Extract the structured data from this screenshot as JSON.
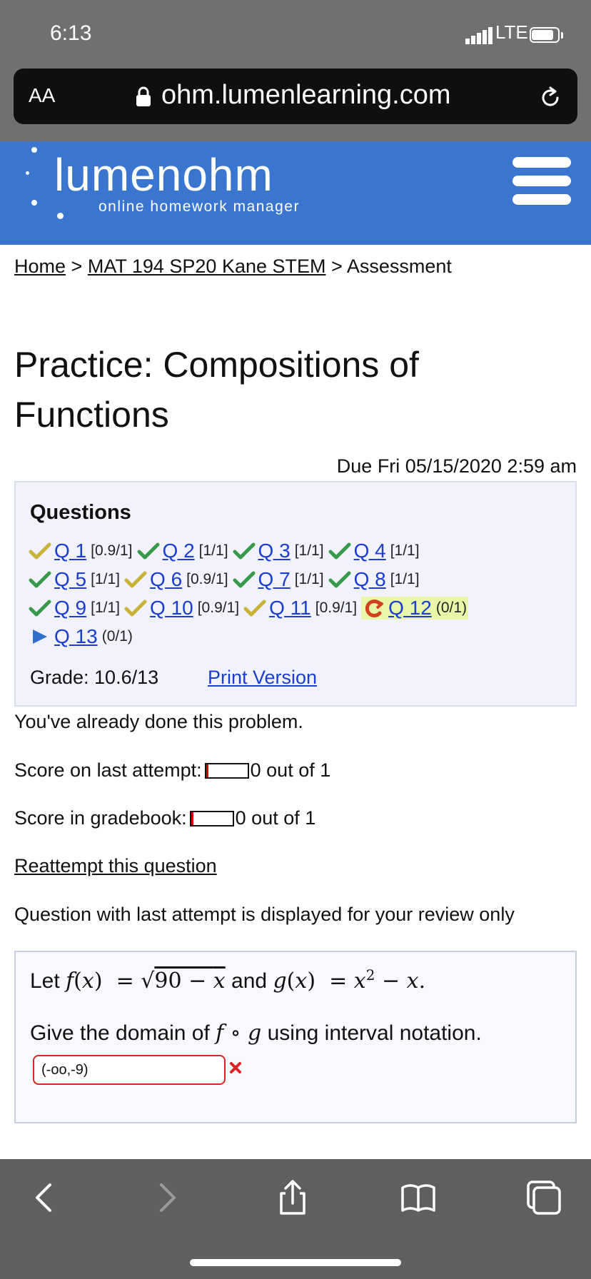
{
  "status": {
    "time": "6:13",
    "network": "LTE"
  },
  "browser": {
    "text_size": "AA",
    "url": "ohm.lumenlearning.com"
  },
  "header": {
    "logo": "lumenohm",
    "tagline": "online homework manager"
  },
  "breadcrumb": {
    "home": "Home",
    "course": "MAT 194 SP20 Kane STEM",
    "current": "Assessment",
    "sep": ">"
  },
  "title": "Practice: Compositions of Functions",
  "due": "Due Fri 05/15/2020 2:59 am",
  "questions": {
    "heading": "Questions",
    "items": [
      {
        "label": "Q 1",
        "score": "[0.9/1]",
        "status": "partial"
      },
      {
        "label": "Q 2",
        "score": "[1/1]",
        "status": "correct"
      },
      {
        "label": "Q 3",
        "score": "[1/1]",
        "status": "correct"
      },
      {
        "label": "Q 4",
        "score": "[1/1]",
        "status": "correct"
      },
      {
        "label": "Q 5",
        "score": "[1/1]",
        "status": "correct"
      },
      {
        "label": "Q 6",
        "score": "[0.9/1]",
        "status": "partial"
      },
      {
        "label": "Q 7",
        "score": "[1/1]",
        "status": "correct"
      },
      {
        "label": "Q 8",
        "score": "[1/1]",
        "status": "correct"
      },
      {
        "label": "Q 9",
        "score": "[1/1]",
        "status": "correct"
      },
      {
        "label": "Q 10",
        "score": "[0.9/1]",
        "status": "partial"
      },
      {
        "label": "Q 11",
        "score": "[0.9/1]",
        "status": "partial"
      },
      {
        "label": "Q 12",
        "score": "(0/1)",
        "status": "retry"
      },
      {
        "label": "Q 13",
        "score": "(0/1)",
        "status": "unattempted"
      }
    ],
    "grade": "Grade: 10.6/13",
    "print": "Print Version"
  },
  "feedback": {
    "done": "You've already done this problem.",
    "last_attempt_label": "Score on last attempt:",
    "last_attempt_value": "0 out of 1",
    "gradebook_label": "Score in gradebook:",
    "gradebook_value": "0 out of 1",
    "reattempt": "Reattempt this question",
    "review_note": "Question with last attempt is displayed for your review only"
  },
  "question": {
    "let": "Let",
    "and": "and",
    "prompt_start": "Give the domain of",
    "prompt_end": "using interval notation.",
    "answer": "(-oo,-9)"
  },
  "colors": {
    "header": "#3a76cf",
    "link": "#1a3ed1",
    "correct": "#3a9a4c",
    "partial": "#c8b23a",
    "retry": "#d0421b",
    "unattempted": "#2f6fce",
    "current_highlight": "#e9f7a8"
  }
}
